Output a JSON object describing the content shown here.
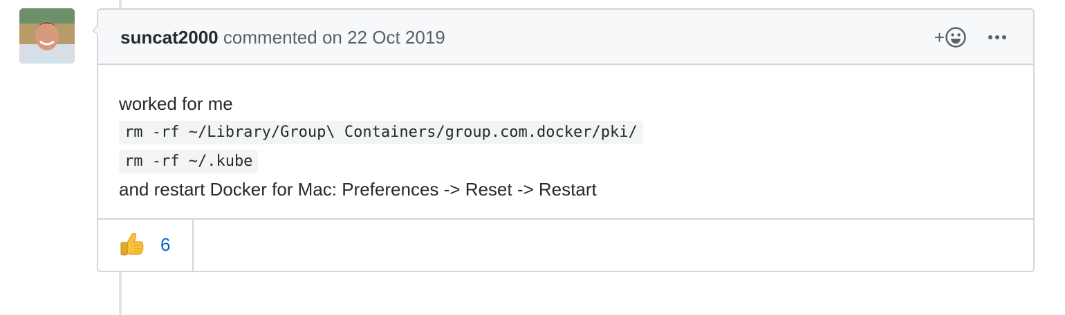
{
  "comment": {
    "author": "suncat2000",
    "action_text": "commented on 22 Oct 2019",
    "body": {
      "intro": "worked for me",
      "code_lines": [
        "rm -rf ~/Library/Group\\ Containers/group.com.docker/pki/",
        "rm -rf ~/.kube"
      ],
      "outro": "and restart Docker for Mac: Preferences -> Reset -> Restart"
    },
    "header_actions": {
      "add_reaction_icon": "smiley-plus-icon",
      "more_options_icon": "kebab-horizontal-icon"
    },
    "reactions": [
      {
        "emoji": "thumbs-up-icon",
        "count": "6"
      }
    ]
  },
  "colors": {
    "border": "#d1d5da",
    "header_bg": "#f6f8fa",
    "link_blue": "#0366d6",
    "muted_text": "#586069"
  }
}
